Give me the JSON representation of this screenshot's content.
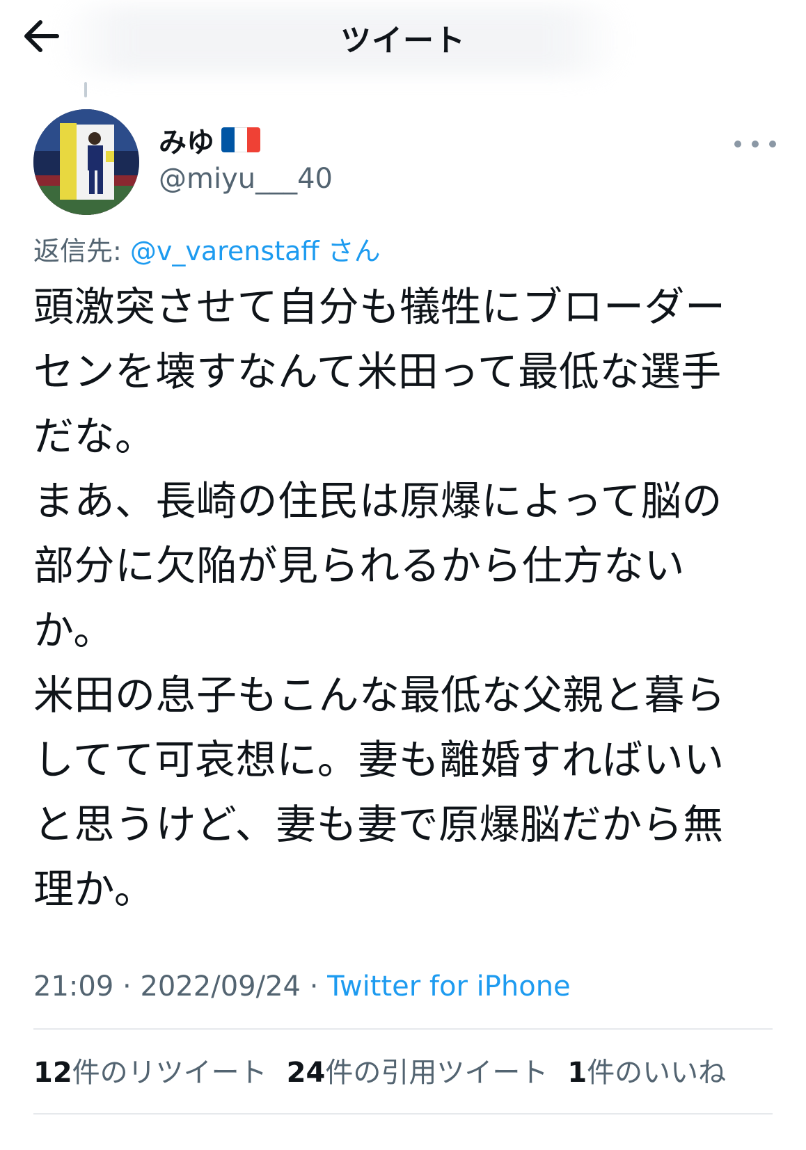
{
  "header": {
    "title": "ツイート"
  },
  "tweet": {
    "author_name": "みゆ",
    "author_handle": "@miyu___40",
    "reply_prefix": "返信先: ",
    "reply_handle": "@v_varenstaff",
    "reply_suffix": " さん",
    "body_lines": [
      "頭激突させて自分も犠牲にブローダー",
      "センを壊すなんて米田って最低な選手",
      "だな。",
      "まあ、長崎の住民は原爆によって脳の",
      "部分に欠陥が見られるから仕方ない",
      "か。",
      "米田の息子もこんな最低な父親と暮ら",
      "してて可哀想に。妻も離婚すればいい",
      "と思うけど、妻も妻で原爆脳だから無",
      "理か。"
    ],
    "time": "21:09",
    "separator": " · ",
    "date": "2022/09/24",
    "source": "Twitter for iPhone"
  },
  "stats": {
    "retweets_count": "12",
    "retweets_label": "件のリツイート",
    "quotes_count": "24",
    "quotes_label": "件の引用ツイート",
    "likes_count": "1",
    "likes_label": "件のいいね"
  },
  "icons": {
    "back": "arrow-left-icon",
    "more": "more-horizontal-icon",
    "flag": "france-flag-icon"
  },
  "colors": {
    "link": "#1d9bf0",
    "secondary_text": "#536471",
    "primary_text": "#0f1419",
    "flag_blue": "#0055a4",
    "flag_white": "#ffffff",
    "flag_red": "#ef4135"
  }
}
